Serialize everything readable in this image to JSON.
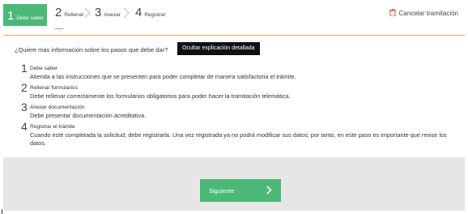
{
  "stepper": {
    "steps": [
      {
        "num": "1",
        "label": "Debe saber"
      },
      {
        "num": "2",
        "label": "Rellenar"
      },
      {
        "num": "3",
        "label": "Anexar"
      },
      {
        "num": "4",
        "label": "Registrar"
      }
    ],
    "cancel_label": "Cancelar tramitación"
  },
  "info": {
    "question": "¿Quiere más información sobre los pasos que debe dar?",
    "toggle_label": "Ocultar explicación detallada",
    "items": [
      {
        "num": "1",
        "title": "Debe saber",
        "desc": "Atienda a las instrucciones que se presenten para poder completar de manera satisfactoria el trámite."
      },
      {
        "num": "2",
        "title": "Rellenar formularios",
        "desc": "Debe rellenar correctamente los formularios obligatorios para poder hacer la tramitación telemática."
      },
      {
        "num": "3",
        "title": "Anexar documentación",
        "desc": "Debe presentar documentación acreditativa."
      },
      {
        "num": "4",
        "title": "Registrar el trámite",
        "desc": "Cuando esté completada la solicitud, debe registrarla. Una vez registrada ya no podrá modificar sus datos; por tanto, en este paso es importante que revise los datos."
      }
    ]
  },
  "footer": {
    "next_label": "Siguiente"
  },
  "colors": {
    "accent": "#4bb878",
    "warning_line": "#f0a24a",
    "cancel_icon": "#d9534f"
  },
  "icons": [
    "chevron-right-icon",
    "trash-icon",
    "arrow-right-icon"
  ]
}
